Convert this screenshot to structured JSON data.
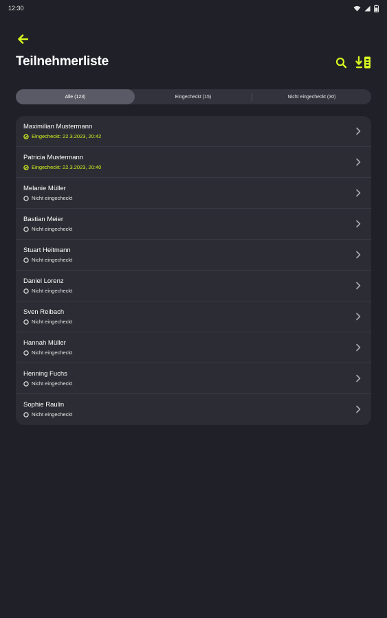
{
  "status_bar": {
    "time": "12:30"
  },
  "header": {
    "title": "Teilnehmerliste"
  },
  "tabs": [
    {
      "label": "Alle (123)",
      "active": true
    },
    {
      "label": "Eingecheckt (15)",
      "active": false
    },
    {
      "label": "Nicht eingecheckt (30)",
      "active": false
    }
  ],
  "colors": {
    "accent": "#d6f51f",
    "background": "#202028",
    "card": "#2c2c34"
  },
  "attendees": [
    {
      "name": "Maximilian Mustermann",
      "status": "Eingecheckt: 22.3.2023, 20:42",
      "checked": true
    },
    {
      "name": "Patricia Mustermann",
      "status": "Eingecheckt: 22.3.2023, 20:40",
      "checked": true
    },
    {
      "name": "Melanie Müller",
      "status": "Nicht eingecheckt",
      "checked": false
    },
    {
      "name": "Bastian Meier",
      "status": "Nicht eingecheckt",
      "checked": false
    },
    {
      "name": "Stuart Heitmann",
      "status": "Nicht eingecheckt",
      "checked": false
    },
    {
      "name": "Daniel Lorenz",
      "status": "Nicht eingecheckt",
      "checked": false
    },
    {
      "name": "Sven Reibach",
      "status": "Nicht eingecheckt",
      "checked": false
    },
    {
      "name": "Hannah Müller",
      "status": "Nicht eingecheckt",
      "checked": false
    },
    {
      "name": "Henning Fuchs",
      "status": "Nicht eingecheckt",
      "checked": false
    },
    {
      "name": "Sophie Raulin",
      "status": "Nicht eingecheckt",
      "checked": false
    }
  ]
}
